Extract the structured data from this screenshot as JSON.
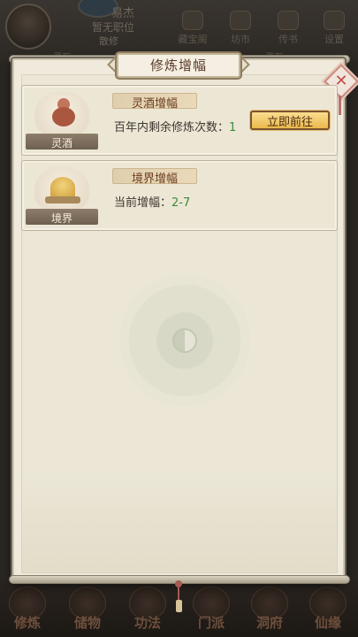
{
  "background": {
    "player_name": "易杰",
    "rank": "暂无职位",
    "sect": "散修",
    "chips": [
      "灵石",
      "灵石"
    ],
    "top_icons": [
      {
        "label": "藏宝阁",
        "icon": "treasure-icon"
      },
      {
        "label": "坊市",
        "icon": "market-icon"
      },
      {
        "label": "传书",
        "icon": "mail-icon"
      },
      {
        "label": "设置",
        "icon": "gear-icon"
      }
    ],
    "bottom_nav": [
      {
        "label": "修炼",
        "icon": "cultivate-icon"
      },
      {
        "label": "储物",
        "icon": "storage-icon"
      },
      {
        "label": "功法",
        "icon": "skill-icon"
      },
      {
        "label": "门派",
        "icon": "sect-icon"
      },
      {
        "label": "洞府",
        "icon": "cave-icon"
      },
      {
        "label": "仙缘",
        "icon": "fate-icon"
      }
    ]
  },
  "modal": {
    "title": "修炼增幅",
    "close_icon": "close-icon",
    "cards": [
      {
        "icon": "wine-gourd-icon",
        "icon_label": "灵酒",
        "tag": "灵酒增幅",
        "text_label": "百年内剩余修炼次数：",
        "text_value": "1",
        "button_label": "立即前往"
      },
      {
        "icon": "realm-mountain-icon",
        "icon_label": "境界",
        "tag": "境界增幅",
        "text_label": "当前增幅：",
        "text_value": "2-7"
      }
    ]
  },
  "colors": {
    "panel_bg": "#efeadb",
    "accent_green": "#3e8a3a",
    "button_gold": "#f0c45c",
    "title_text": "#5b3a2a"
  }
}
